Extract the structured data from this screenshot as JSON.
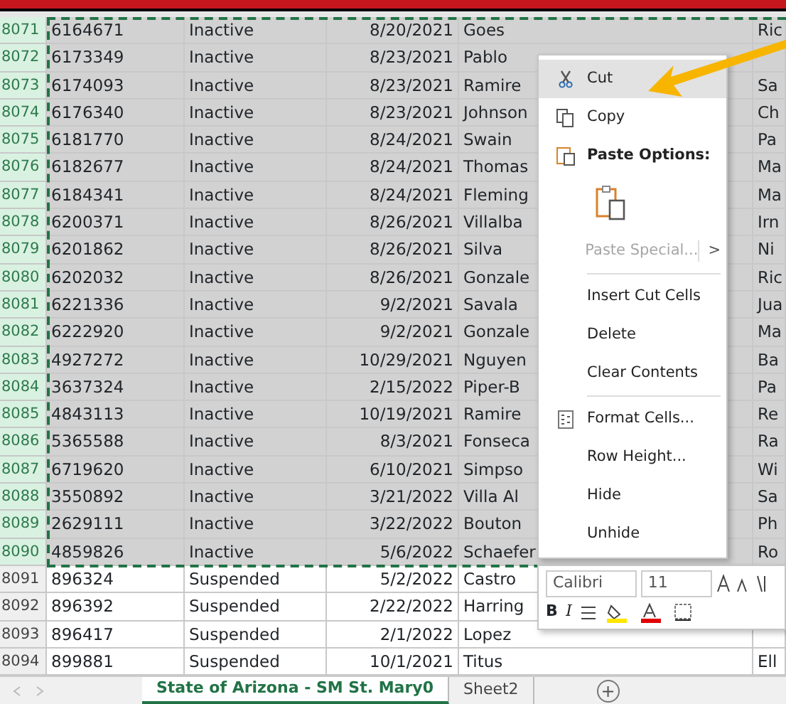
{
  "rows": [
    {
      "num": "8071",
      "id": "6164671",
      "status": "Inactive",
      "date": "8/20/2021",
      "name": "Goes",
      "col_6": "Ric",
      "selected": true
    },
    {
      "num": "8072",
      "id": "6173349",
      "status": "Inactive",
      "date": "8/23/2021",
      "name": "Pablo",
      "selected": true
    },
    {
      "num": "8073",
      "id": "6174093",
      "status": "Inactive",
      "date": "8/23/2021",
      "name": "Ramire",
      "col_6": "Sa",
      "selected": true
    },
    {
      "num": "8074",
      "id": "6176340",
      "status": "Inactive",
      "date": "8/23/2021",
      "name": "Johnson",
      "col_6": "Ch",
      "selected": true
    },
    {
      "num": "8075",
      "id": "6181770",
      "status": "Inactive",
      "date": "8/24/2021",
      "name": "Swain",
      "col_6": "Pa",
      "selected": true
    },
    {
      "num": "8076",
      "id": "6182677",
      "status": "Inactive",
      "date": "8/24/2021",
      "name": "Thomas",
      "col_6": "Ma",
      "selected": true
    },
    {
      "num": "8077",
      "id": "6184341",
      "status": "Inactive",
      "date": "8/24/2021",
      "name": "Fleming",
      "col_6": "Ma",
      "selected": true
    },
    {
      "num": "8078",
      "id": "6200371",
      "status": "Inactive",
      "date": "8/26/2021",
      "name": "Villalba",
      "col_6": "Irn",
      "selected": true
    },
    {
      "num": "8079",
      "id": "6201862",
      "status": "Inactive",
      "date": "8/26/2021",
      "name": "Silva",
      "col_6": "Ni",
      "selected": true
    },
    {
      "num": "8080",
      "id": "6202032",
      "status": "Inactive",
      "date": "8/26/2021",
      "name": "Gonzale",
      "col_6": "Ric",
      "selected": true
    },
    {
      "num": "8081",
      "id": "6221336",
      "status": "Inactive",
      "date": "9/2/2021",
      "name": "Savala",
      "col_6": "Jua",
      "selected": true
    },
    {
      "num": "8082",
      "id": "6222920",
      "status": "Inactive",
      "date": "9/2/2021",
      "name": "Gonzale",
      "col_6": "Ma",
      "selected": true
    },
    {
      "num": "8083",
      "id": "4927272",
      "status": "Inactive",
      "date": "10/29/2021",
      "name": "Nguyen",
      "col_6": "Ba",
      "selected": true
    },
    {
      "num": "8084",
      "id": "3637324",
      "status": "Inactive",
      "date": "2/15/2022",
      "name": "Piper-B",
      "col_6": "Pa",
      "selected": true
    },
    {
      "num": "8085",
      "id": "4843113",
      "status": "Inactive",
      "date": "10/19/2021",
      "name": "Ramire",
      "col_6": "Re",
      "selected": true
    },
    {
      "num": "8086",
      "id": "5365588",
      "status": "Inactive",
      "date": "8/3/2021",
      "name": "Fonseca",
      "col_6": "Ra",
      "selected": true
    },
    {
      "num": "8087",
      "id": "6719620",
      "status": "Inactive",
      "date": "6/10/2021",
      "name": "Simpso",
      "col_6": "Wi",
      "selected": true
    },
    {
      "num": "8088",
      "id": "3550892",
      "status": "Inactive",
      "date": "3/21/2022",
      "name": "Villa Al",
      "col_6": "Sa",
      "selected": true
    },
    {
      "num": "8089",
      "id": "2629111",
      "status": "Inactive",
      "date": "3/22/2022",
      "name": "Bouton",
      "col_6": "Ph",
      "selected": true
    },
    {
      "num": "8090",
      "id": "4859826",
      "status": "Inactive",
      "date": "5/6/2022",
      "name": "Schaefer",
      "col_6": "Ro",
      "selected": true
    },
    {
      "num": "8091",
      "id": "896324",
      "status": "Suspended",
      "date": "5/2/2022",
      "name": "Castro",
      "selected": false
    },
    {
      "num": "8092",
      "id": "896392",
      "status": "Suspended",
      "date": "2/22/2022",
      "name": "Harring",
      "selected": false
    },
    {
      "num": "8093",
      "id": "896417",
      "status": "Suspended",
      "date": "2/1/2022",
      "name": "Lopez",
      "selected": false
    },
    {
      "num": "8094",
      "id": "899881",
      "status": "Suspended",
      "date": "10/1/2021",
      "name": "Titus",
      "col_6": "Ell",
      "selected": false
    }
  ],
  "context_menu": [
    {
      "kind": "item",
      "label": "Cut",
      "highlighted": true,
      "disabled": false
    },
    {
      "kind": "item",
      "label": "Copy",
      "highlighted": false,
      "disabled": false
    },
    {
      "kind": "header",
      "label": "Paste Options:"
    },
    {
      "kind": "paste"
    },
    {
      "kind": "submenu",
      "label": "Paste Special...",
      "arrow": ">",
      "highlighted": false,
      "disabled": true
    },
    {
      "kind": "divider"
    },
    {
      "kind": "item",
      "label": "Insert Cut Cells",
      "highlighted": false,
      "disabled": false
    },
    {
      "kind": "item",
      "label": "Delete",
      "highlighted": false,
      "disabled": false
    },
    {
      "kind": "item",
      "label": "Clear Contents",
      "highlighted": false,
      "disabled": false
    },
    {
      "kind": "divider"
    },
    {
      "kind": "item",
      "label": "Format Cells...",
      "highlighted": false,
      "disabled": false
    },
    {
      "kind": "item",
      "label": "Row Height...",
      "highlighted": false,
      "disabled": false
    },
    {
      "kind": "item",
      "label": "Hide",
      "highlighted": false,
      "disabled": false
    },
    {
      "kind": "item",
      "label": "Unhide",
      "highlighted": false,
      "disabled": false
    }
  ],
  "mini_toolbar": {
    "font": "Calibri",
    "size": "11",
    "bold": "B",
    "italic": "I"
  },
  "sheet_tabs": [
    {
      "label": "State of Arizona - SM St. Mary0",
      "selected": true
    },
    {
      "label": "Sheet2",
      "selected": false
    }
  ],
  "add_sheet": "+"
}
